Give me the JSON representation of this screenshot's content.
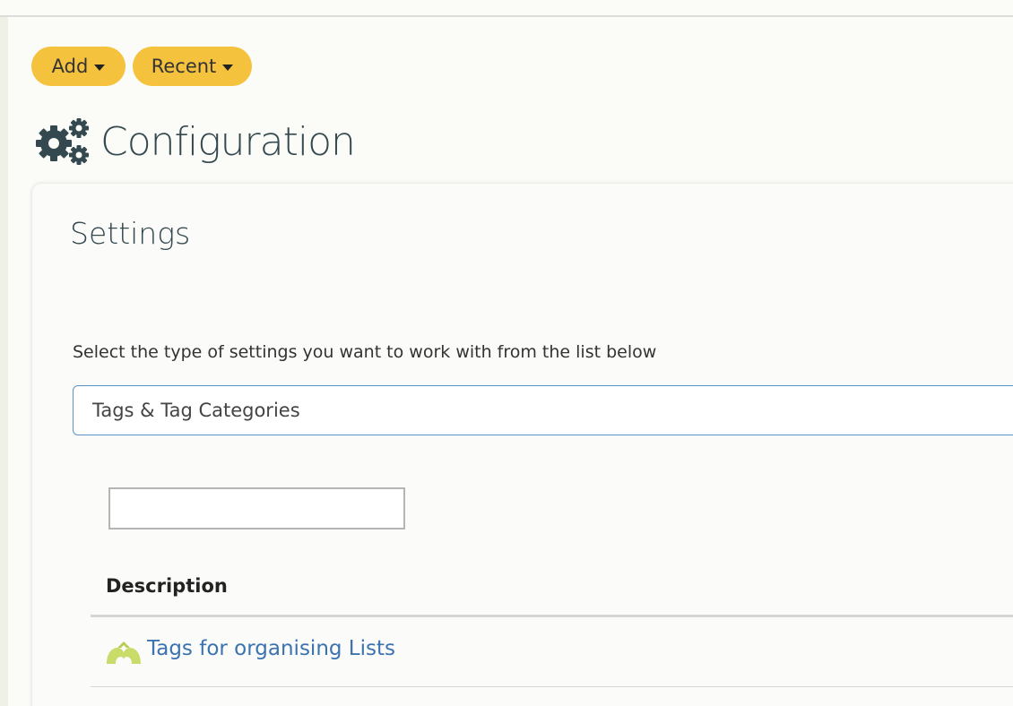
{
  "toolbar": {
    "add_label": "Add",
    "recent_label": "Recent"
  },
  "page": {
    "title": "Configuration",
    "icon": "gears-icon"
  },
  "settings": {
    "heading": "Settings",
    "instruction": "Select the type of settings you want to work with from the list below",
    "selected_type": "Tags & Tag Categories",
    "filter_value": ""
  },
  "table": {
    "columns": [
      "Description"
    ],
    "rows": [
      {
        "icon": "tag-category-icon",
        "label": "Tags for organising Lists"
      }
    ]
  },
  "colors": {
    "accent": "#f5c23e",
    "title": "#34494f",
    "link": "#3b73b0",
    "select_border": "#5b93c7",
    "icon_green": "#c9dc6a"
  }
}
